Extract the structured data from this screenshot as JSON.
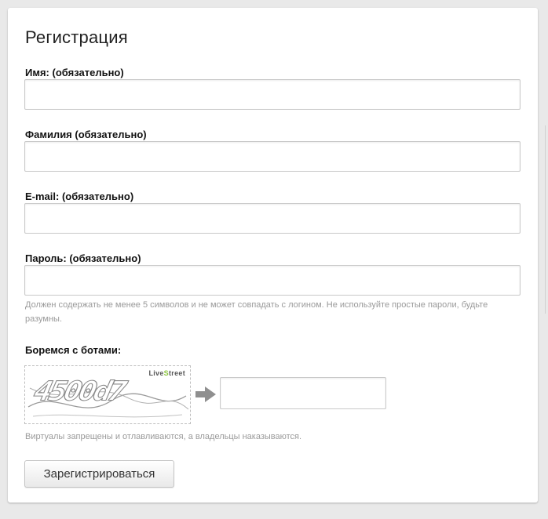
{
  "form": {
    "title": "Регистрация",
    "fields": [
      {
        "label": "Имя: (обязательно)",
        "value": "",
        "placeholder": ""
      },
      {
        "label": "Фамилия (обязательно)",
        "value": "",
        "placeholder": ""
      },
      {
        "label": "E-mail: (обязательно)",
        "value": "",
        "placeholder": ""
      },
      {
        "label": "Пароль: (обязательно)",
        "value": "",
        "placeholder": ""
      }
    ],
    "password_hint": "Должен содержать не менее 5 символов и не может совпадать с логином. Не используйте простые пароли, будьте разумны."
  },
  "captcha": {
    "label": "Боремся с ботами:",
    "code": "4500d7",
    "brand_prefix": "Live",
    "brand_accent": "S",
    "brand_suffix": "treet",
    "input_value": "",
    "note": "Виртуалы запрещены и отлавливаются, а владельцы наказываются."
  },
  "submit": {
    "label": "Зарегистрироваться"
  },
  "colors": {
    "background": "#e9e9e9",
    "card": "#ffffff",
    "hint_text": "#9a9a9a",
    "brand_accent": "#8cc63f"
  }
}
